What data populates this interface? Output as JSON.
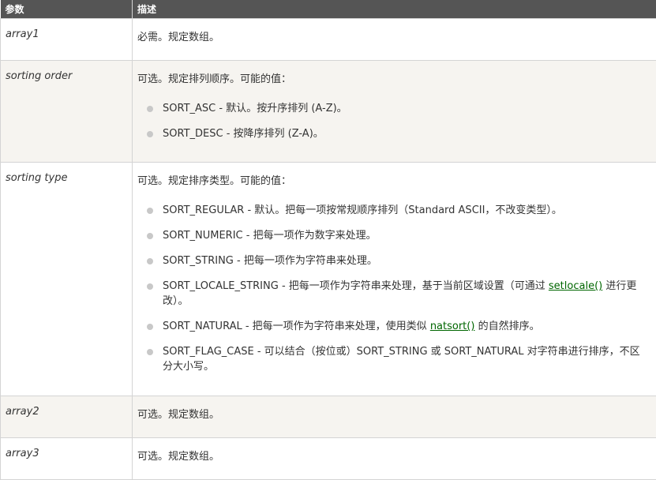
{
  "header": {
    "col1": "参数",
    "col2": "描述"
  },
  "rows": [
    {
      "param": "array1",
      "desc": "必需。规定数组。"
    },
    {
      "param": "sorting order",
      "desc": "可选。规定排列顺序。可能的值：",
      "items": [
        "SORT_ASC - 默认。按升序排列 (A-Z)。",
        "SORT_DESC - 按降序排列 (Z-A)。"
      ]
    },
    {
      "param": "sorting type",
      "desc": "可选。规定排序类型。可能的值：",
      "items": [
        "SORT_REGULAR - 默认。把每一项按常规顺序排列（Standard ASCII，不改变类型）。",
        "SORT_NUMERIC - 把每一项作为数字来处理。",
        "SORT_STRING - 把每一项作为字符串来处理。",
        {
          "pre": "SORT_LOCALE_STRING - 把每一项作为字符串来处理，基于当前区域设置（可通过 ",
          "link": "setlocale()",
          "post": " 进行更改）。"
        },
        {
          "pre": "SORT_NATURAL - 把每一项作为字符串来处理，使用类似 ",
          "link": "natsort()",
          "post": " 的自然排序。"
        },
        "SORT_FLAG_CASE - 可以结合（按位或）SORT_STRING 或 SORT_NATURAL 对字符串进行排序，不区分大小写。"
      ]
    },
    {
      "param": "array2",
      "desc": "可选。规定数组。"
    },
    {
      "param": "array3",
      "desc": "可选。规定数组。"
    }
  ]
}
